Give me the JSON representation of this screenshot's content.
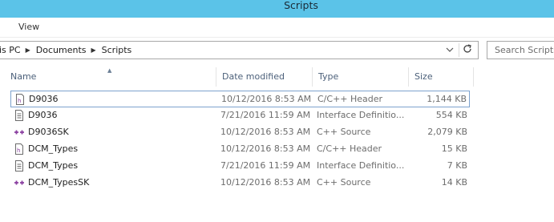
{
  "window": {
    "title": "Scripts"
  },
  "ribbon": {
    "view_tab": "View"
  },
  "address": {
    "crumbs": [
      "is PC",
      "Documents",
      "Scripts"
    ],
    "dropdown_icon": "chevron-down-icon",
    "refresh_icon": "refresh-icon"
  },
  "search": {
    "placeholder": "Search Scripts"
  },
  "columns": {
    "name": "Name",
    "date": "Date modified",
    "type": "Type",
    "size": "Size"
  },
  "files": [
    {
      "name": "D9036",
      "date": "10/12/2016 8:53 AM",
      "type": "C/C++ Header",
      "size": "1,144 KB",
      "icon": "header-file-icon",
      "selected": true
    },
    {
      "name": "D9036",
      "date": "7/21/2016 11:59 AM",
      "type": "Interface Definitio...",
      "size": "554 KB",
      "icon": "text-file-icon",
      "selected": false
    },
    {
      "name": "D9036SK",
      "date": "10/12/2016 8:53 AM",
      "type": "C++ Source",
      "size": "2,079 KB",
      "icon": "cpp-source-file-icon",
      "selected": false
    },
    {
      "name": "DCM_Types",
      "date": "10/12/2016 8:53 AM",
      "type": "C/C++ Header",
      "size": "15 KB",
      "icon": "header-file-icon",
      "selected": false
    },
    {
      "name": "DCM_Types",
      "date": "7/21/2016 11:59 AM",
      "type": "Interface Definitio...",
      "size": "7 KB",
      "icon": "text-file-icon",
      "selected": false
    },
    {
      "name": "DCM_TypesSK",
      "date": "10/12/2016 8:53 AM",
      "type": "C++ Source",
      "size": "14 KB",
      "icon": "cpp-source-file-icon",
      "selected": false
    }
  ],
  "colors": {
    "titlebar": "#5bc3e8",
    "header_text": "#4c607a",
    "selection_border": "#7da2ce",
    "cpp_icon": "#8a3fa0"
  }
}
